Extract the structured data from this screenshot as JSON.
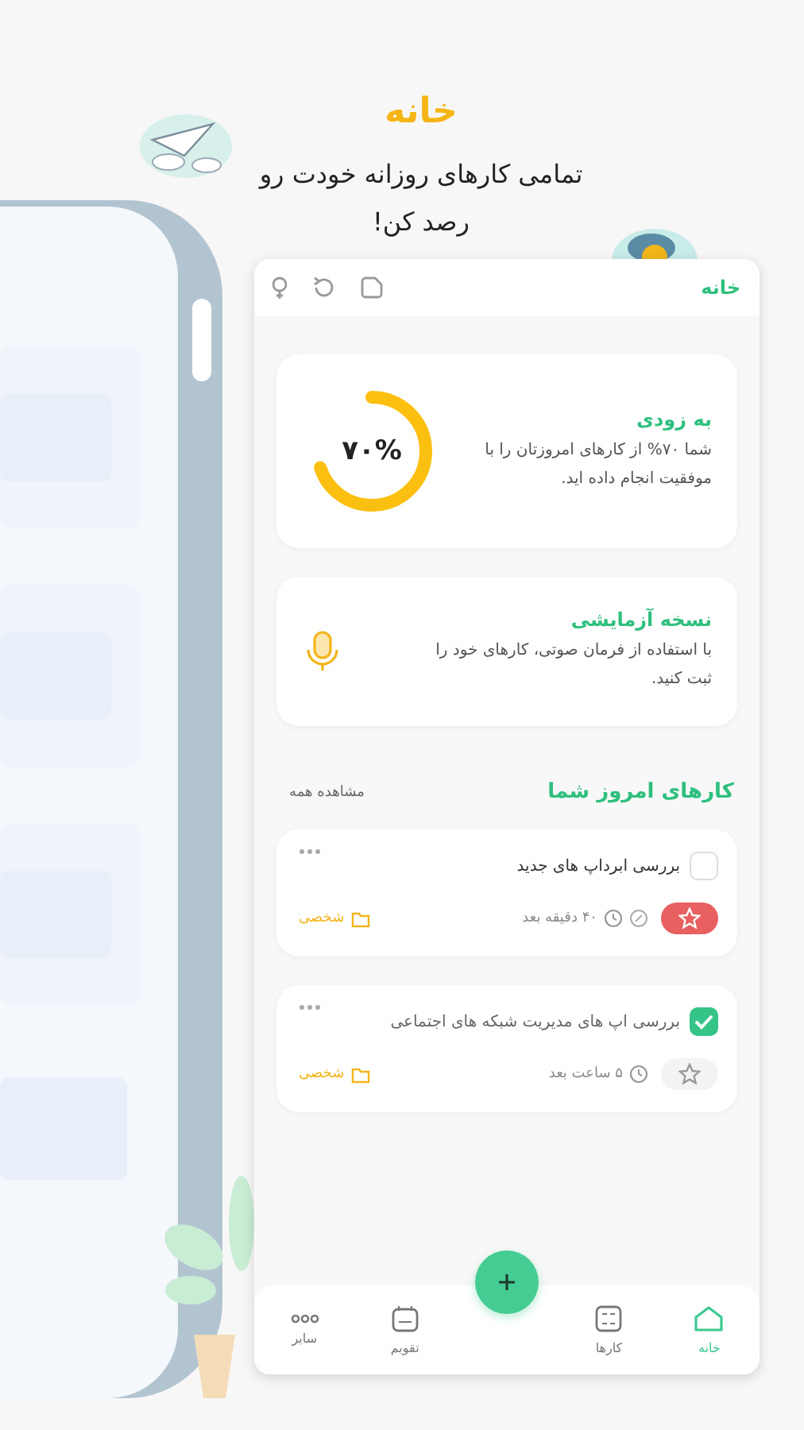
{
  "hero": {
    "title": "خانه",
    "subtitle": "تمامی کارهای روزانه خودت رو رصد کن!"
  },
  "app": {
    "header": {
      "title": "خانه"
    },
    "progress_card": {
      "title": "به زودی",
      "text": "شما ۷۰% از کارهای امروزتان را با موفقیت انجام داده اید.",
      "reading": "۷۰%",
      "level": 0.7
    },
    "voice_card": {
      "title": "نسخه آزمایشی",
      "text": "با استفاده از فرمان صوتی، کارهای خود را ثبت کنید."
    },
    "section": {
      "title": "کارهای امروز شما",
      "link": "مشاهده همه"
    },
    "tasks": [
      {
        "title": "بررسی ابرداپ های جدید",
        "checked": false,
        "starred": true,
        "attachment": true,
        "time": "۴۰ دقیقه بعد",
        "category": "شخصی"
      },
      {
        "title": "بررسی اپ های مدیریت شبکه های اجتماعی",
        "checked": true,
        "starred": false,
        "attachment": false,
        "time": "۵ ساعت بعد",
        "category": "شخصی"
      }
    ],
    "nav": [
      {
        "kind": "home",
        "label": "خانه",
        "selected": true
      },
      {
        "kind": "tasks",
        "label": "کارها",
        "selected": false
      },
      {
        "kind": "fab"
      },
      {
        "kind": "calendar",
        "label": "تقویم",
        "selected": false
      },
      {
        "kind": "more",
        "label": "سایر",
        "selected": false
      }
    ]
  }
}
